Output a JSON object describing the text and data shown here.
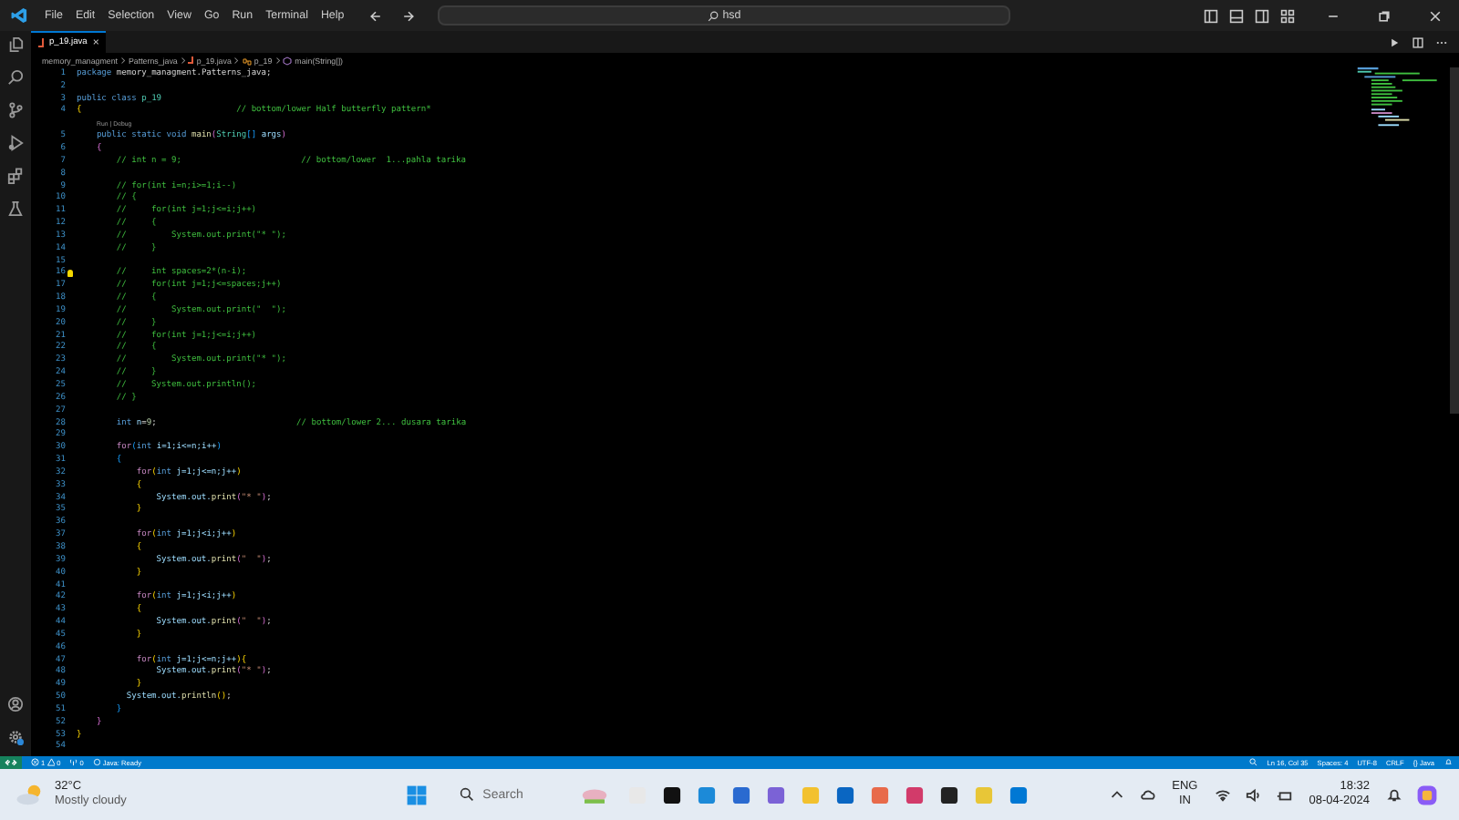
{
  "menu": [
    "File",
    "Edit",
    "Selection",
    "View",
    "Go",
    "Run",
    "Terminal",
    "Help"
  ],
  "search": {
    "value": "hsd"
  },
  "tab": {
    "label": "p_19.java",
    "close": "×"
  },
  "breadcrumbs": [
    {
      "kind": "folder",
      "label": "memory_managment"
    },
    {
      "kind": "folder",
      "label": "Patterns_java"
    },
    {
      "kind": "file",
      "label": "p_19.java"
    },
    {
      "kind": "class",
      "label": "p_19"
    },
    {
      "kind": "method",
      "label": "main(String[])"
    }
  ],
  "editor": {
    "lines": [
      {
        "kind": "code",
        "number": "1",
        "tokens": [
          {
            "kind": "kw",
            "text": "package"
          },
          {
            "kind": "p",
            "text": " memory_managment.Patterns_java;"
          }
        ]
      },
      {
        "kind": "code",
        "number": "2"
      },
      {
        "kind": "code",
        "number": "3",
        "tokens": [
          {
            "kind": "kw",
            "text": "public class"
          },
          {
            "kind": "type",
            "text": " p_19"
          }
        ]
      },
      {
        "kind": "code",
        "number": "4",
        "tokens": [
          {
            "kind": "b1",
            "text": "{"
          },
          {
            "kind": "com",
            "text": "                               // bottom/lower Half butterfly pattern*"
          }
        ]
      },
      {
        "kind": "lens",
        "links": [
          "Run",
          "Debug"
        ],
        "separator": "|"
      },
      {
        "kind": "code",
        "number": "5",
        "tokens": [
          {
            "kind": "kw",
            "text": "    public static void"
          },
          {
            "kind": "fn",
            "text": " main"
          },
          {
            "kind": "b2",
            "text": "("
          },
          {
            "kind": "type",
            "text": "String"
          },
          {
            "kind": "b3",
            "text": "[]"
          },
          {
            "kind": "id",
            "text": " args"
          },
          {
            "kind": "b2",
            "text": ")"
          }
        ]
      },
      {
        "kind": "code",
        "number": "6",
        "tokens": [
          {
            "kind": "b2",
            "text": "    {"
          }
        ]
      },
      {
        "kind": "code",
        "number": "7",
        "tokens": [
          {
            "kind": "com",
            "text": "        // int n = 9;                        // bottom/lower  1...pahla tarika"
          }
        ]
      },
      {
        "kind": "code",
        "number": "8"
      },
      {
        "kind": "code",
        "number": "9",
        "tokens": [
          {
            "kind": "com",
            "text": "        // for(int i=n;i>=1;i--)"
          }
        ]
      },
      {
        "kind": "code",
        "number": "10",
        "tokens": [
          {
            "kind": "com",
            "text": "        // {"
          }
        ]
      },
      {
        "kind": "code",
        "number": "11",
        "tokens": [
          {
            "kind": "com",
            "text": "        //     for(int j=1;j<=i;j++)"
          }
        ]
      },
      {
        "kind": "code",
        "number": "12",
        "tokens": [
          {
            "kind": "com",
            "text": "        //     {"
          }
        ]
      },
      {
        "kind": "code",
        "number": "13",
        "tokens": [
          {
            "kind": "com",
            "text": "        //         System.out.print(\"* \");"
          }
        ]
      },
      {
        "kind": "code",
        "number": "14",
        "tokens": [
          {
            "kind": "com",
            "text": "        //     }"
          }
        ]
      },
      {
        "kind": "code",
        "number": "15"
      },
      {
        "kind": "code",
        "number": "16",
        "lightbulb": true,
        "tokens": [
          {
            "kind": "com",
            "text": "        //     int spaces=2*(n-i);"
          }
        ]
      },
      {
        "kind": "code",
        "number": "17",
        "tokens": [
          {
            "kind": "com",
            "text": "        //     for(int j=1;j<=spaces;j++)"
          }
        ]
      },
      {
        "kind": "code",
        "number": "18",
        "tokens": [
          {
            "kind": "com",
            "text": "        //     {"
          }
        ]
      },
      {
        "kind": "code",
        "number": "19",
        "tokens": [
          {
            "kind": "com",
            "text": "        //         System.out.print(\"  \");"
          }
        ]
      },
      {
        "kind": "code",
        "number": "20",
        "tokens": [
          {
            "kind": "com",
            "text": "        //     }"
          }
        ]
      },
      {
        "kind": "code",
        "number": "21",
        "tokens": [
          {
            "kind": "com",
            "text": "        //     for(int j=1;j<=i;j++)"
          }
        ]
      },
      {
        "kind": "code",
        "number": "22",
        "tokens": [
          {
            "kind": "com",
            "text": "        //     {"
          }
        ]
      },
      {
        "kind": "code",
        "number": "23",
        "tokens": [
          {
            "kind": "com",
            "text": "        //         System.out.print(\"* \");"
          }
        ]
      },
      {
        "kind": "code",
        "number": "24",
        "tokens": [
          {
            "kind": "com",
            "text": "        //     }"
          }
        ]
      },
      {
        "kind": "code",
        "number": "25",
        "tokens": [
          {
            "kind": "com",
            "text": "        //     System.out.println();"
          }
        ]
      },
      {
        "kind": "code",
        "number": "26",
        "tokens": [
          {
            "kind": "com",
            "text": "        // }"
          }
        ]
      },
      {
        "kind": "code",
        "number": "27"
      },
      {
        "kind": "code",
        "number": "28",
        "tokens": [
          {
            "kind": "kw",
            "text": "        int"
          },
          {
            "kind": "id",
            "text": " n"
          },
          {
            "kind": "p",
            "text": "="
          },
          {
            "kind": "num",
            "text": "9"
          },
          {
            "kind": "p",
            "text": ";"
          },
          {
            "kind": "com",
            "text": "                            // bottom/lower 2... dusara tarika"
          }
        ]
      },
      {
        "kind": "code",
        "number": "29"
      },
      {
        "kind": "code",
        "number": "30",
        "tokens": [
          {
            "kind": "ctl",
            "text": "        for"
          },
          {
            "kind": "b3",
            "text": "("
          },
          {
            "kind": "kw",
            "text": "int"
          },
          {
            "kind": "id",
            "text": " i=1;i<=n;i++"
          },
          {
            "kind": "b3",
            "text": ")"
          }
        ]
      },
      {
        "kind": "code",
        "number": "31",
        "tokens": [
          {
            "kind": "b3",
            "text": "        {"
          }
        ]
      },
      {
        "kind": "code",
        "number": "32",
        "tokens": [
          {
            "kind": "ctl",
            "text": "            for"
          },
          {
            "kind": "b1",
            "text": "("
          },
          {
            "kind": "kw",
            "text": "int"
          },
          {
            "kind": "id",
            "text": " j=1;j<=n;j++"
          },
          {
            "kind": "b1",
            "text": ")"
          }
        ]
      },
      {
        "kind": "code",
        "number": "33",
        "tokens": [
          {
            "kind": "b1",
            "text": "            {"
          }
        ]
      },
      {
        "kind": "code",
        "number": "34",
        "tokens": [
          {
            "kind": "id",
            "text": "                System.out."
          },
          {
            "kind": "fn",
            "text": "print"
          },
          {
            "kind": "b2",
            "text": "("
          },
          {
            "kind": "str",
            "text": "\"* \""
          },
          {
            "kind": "b2",
            "text": ")"
          },
          {
            "kind": "p",
            "text": ";"
          }
        ]
      },
      {
        "kind": "code",
        "number": "35",
        "tokens": [
          {
            "kind": "b1",
            "text": "            }"
          }
        ]
      },
      {
        "kind": "code",
        "number": "36"
      },
      {
        "kind": "code",
        "number": "37",
        "tokens": [
          {
            "kind": "ctl",
            "text": "            for"
          },
          {
            "kind": "b1",
            "text": "("
          },
          {
            "kind": "kw",
            "text": "int"
          },
          {
            "kind": "id",
            "text": " j=1;j<i;j++"
          },
          {
            "kind": "b1",
            "text": ")"
          }
        ]
      },
      {
        "kind": "code",
        "number": "38",
        "tokens": [
          {
            "kind": "b1",
            "text": "            {"
          }
        ]
      },
      {
        "kind": "code",
        "number": "39",
        "tokens": [
          {
            "kind": "id",
            "text": "                System.out."
          },
          {
            "kind": "fn",
            "text": "print"
          },
          {
            "kind": "b2",
            "text": "("
          },
          {
            "kind": "str",
            "text": "\"  \""
          },
          {
            "kind": "b2",
            "text": ")"
          },
          {
            "kind": "p",
            "text": ";"
          }
        ]
      },
      {
        "kind": "code",
        "number": "40",
        "tokens": [
          {
            "kind": "b1",
            "text": "            }"
          }
        ]
      },
      {
        "kind": "code",
        "number": "41"
      },
      {
        "kind": "code",
        "number": "42",
        "tokens": [
          {
            "kind": "ctl",
            "text": "            for"
          },
          {
            "kind": "b1",
            "text": "("
          },
          {
            "kind": "kw",
            "text": "int"
          },
          {
            "kind": "id",
            "text": " j=1;j<i;j++"
          },
          {
            "kind": "b1",
            "text": ")"
          }
        ]
      },
      {
        "kind": "code",
        "number": "43",
        "tokens": [
          {
            "kind": "b1",
            "text": "            {"
          }
        ]
      },
      {
        "kind": "code",
        "number": "44",
        "tokens": [
          {
            "kind": "id",
            "text": "                System.out."
          },
          {
            "kind": "fn",
            "text": "print"
          },
          {
            "kind": "b2",
            "text": "("
          },
          {
            "kind": "str",
            "text": "\"  \""
          },
          {
            "kind": "b2",
            "text": ")"
          },
          {
            "kind": "p",
            "text": ";"
          }
        ]
      },
      {
        "kind": "code",
        "number": "45",
        "tokens": [
          {
            "kind": "b1",
            "text": "            }"
          }
        ]
      },
      {
        "kind": "code",
        "number": "46"
      },
      {
        "kind": "code",
        "number": "47",
        "tokens": [
          {
            "kind": "ctl",
            "text": "            for"
          },
          {
            "kind": "b1",
            "text": "("
          },
          {
            "kind": "kw",
            "text": "int"
          },
          {
            "kind": "id",
            "text": " j=1;j<=n;j++"
          },
          {
            "kind": "b1",
            "text": ")"
          },
          {
            "kind": "b1",
            "text": "{"
          }
        ]
      },
      {
        "kind": "code",
        "number": "48",
        "tokens": [
          {
            "kind": "id",
            "text": "                System.out."
          },
          {
            "kind": "fn",
            "text": "print"
          },
          {
            "kind": "b2",
            "text": "("
          },
          {
            "kind": "str",
            "text": "\"* \""
          },
          {
            "kind": "b2",
            "text": ")"
          },
          {
            "kind": "p",
            "text": ";"
          }
        ]
      },
      {
        "kind": "code",
        "number": "49",
        "tokens": [
          {
            "kind": "b1",
            "text": "            }"
          }
        ]
      },
      {
        "kind": "code",
        "number": "50",
        "tokens": [
          {
            "kind": "id",
            "text": "          System.out."
          },
          {
            "kind": "fn",
            "text": "println"
          },
          {
            "kind": "b1",
            "text": "()"
          },
          {
            "kind": "p",
            "text": ";"
          }
        ]
      },
      {
        "kind": "code",
        "number": "51",
        "tokens": [
          {
            "kind": "b3",
            "text": "        }"
          }
        ]
      },
      {
        "kind": "code",
        "number": "52",
        "tokens": [
          {
            "kind": "b2",
            "text": "    }"
          }
        ]
      },
      {
        "kind": "code",
        "number": "53",
        "tokens": [
          {
            "kind": "b1",
            "text": "}"
          }
        ]
      },
      {
        "kind": "code",
        "number": "54"
      }
    ]
  },
  "status_bar": {
    "errors": "1",
    "warnings": "0",
    "ports": "0",
    "java_status": "Java: Ready",
    "position": "Ln 16, Col 35",
    "indent": "Spaces: 4",
    "encoding": "UTF-8",
    "eol": "CRLF",
    "language": "{} Java"
  },
  "taskbar": {
    "temperature": "32°C",
    "weather": "Mostly cloudy",
    "search_placeholder": "Search",
    "language": "ENG",
    "region": "IN",
    "time": "18:32",
    "date": "08-04-2024"
  }
}
